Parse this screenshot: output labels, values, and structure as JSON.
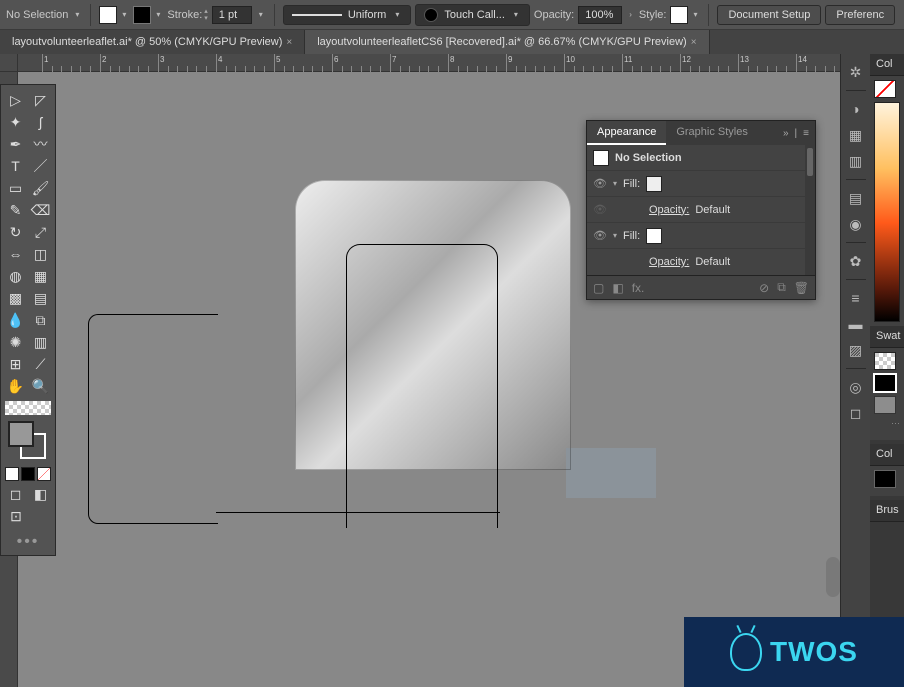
{
  "topbar": {
    "selection": "No Selection",
    "stroke_label": "Stroke:",
    "stroke_value": "1 pt",
    "uniform": "Uniform",
    "brush": "Touch Call...",
    "opacity_label": "Opacity:",
    "opacity_value": "100%",
    "style_label": "Style:",
    "btn_docsetup": "Document Setup",
    "btn_prefs": "Preferenc"
  },
  "tabs": [
    {
      "label": "layoutvolunteerleaflet.ai* @ 50% (CMYK/GPU Preview)",
      "active": false
    },
    {
      "label": "layoutvolunteerleafletCS6 [Recovered].ai* @ 66.67% (CMYK/GPU Preview)",
      "active": true
    }
  ],
  "ruler_nums": [
    "1",
    "2",
    "3",
    "4",
    "5",
    "6",
    "7",
    "8",
    "9",
    "10",
    "11",
    "12",
    "13",
    "14"
  ],
  "appearance": {
    "tab1": "Appearance",
    "tab2": "Graphic Styles",
    "header": "No Selection",
    "rows": [
      {
        "label": "Fill:",
        "swatch": "#eeeeee"
      },
      {
        "label": "Opacity:",
        "value": "Default",
        "indent": true
      },
      {
        "label": "Fill:",
        "swatch": "#ffffff"
      },
      {
        "label": "Opacity:",
        "value": "Default",
        "indent": true
      }
    ],
    "fx_label": "fx."
  },
  "right_panels": {
    "p1": "Col",
    "p2": "Swat",
    "p3": "Col",
    "p4": "Brus"
  },
  "brand": "TWOS"
}
